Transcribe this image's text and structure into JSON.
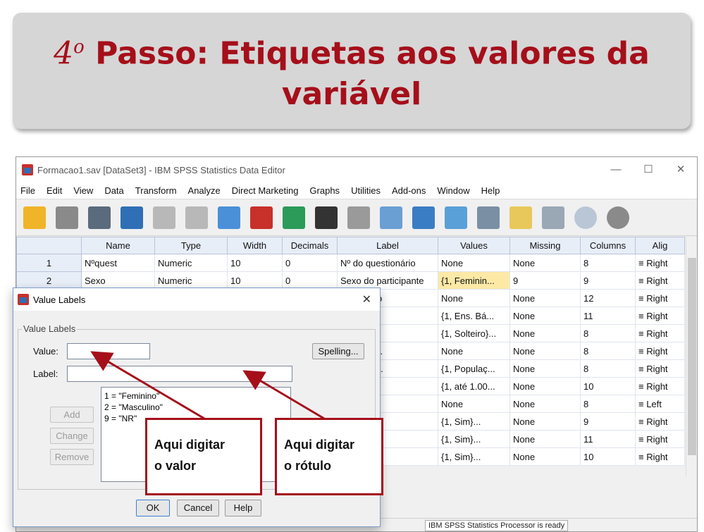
{
  "slide": {
    "title_num": "4",
    "title_sup": "o",
    "title_line1_rest": " Passo: Etiquetas aos valores da",
    "title_line2": "variável"
  },
  "window": {
    "title": "Formacao1.sav [DataSet3] - IBM SPSS Statistics Data Editor",
    "controls": [
      "—",
      "☐",
      "✕"
    ],
    "menu": [
      "File",
      "Edit",
      "View",
      "Data",
      "Transform",
      "Analyze",
      "Direct Marketing",
      "Graphs",
      "Utilities",
      "Add-ons",
      "Window",
      "Help"
    ]
  },
  "grid": {
    "columns": [
      "",
      "Name",
      "Type",
      "Width",
      "Decimals",
      "Label",
      "Values",
      "Missing",
      "Columns",
      "Alig"
    ],
    "rows": [
      {
        "n": "1",
        "name": "Nºquest",
        "type": "Numeric",
        "width": "10",
        "decimals": "0",
        "label": "Nº do questionário",
        "values": "None",
        "missing": "None",
        "columns": "8",
        "align": "≡ Right"
      },
      {
        "n": "2",
        "name": "Sexo",
        "type": "Numeric",
        "width": "10",
        "decimals": "0",
        "label": "Sexo do participante",
        "values": "{1, Feminin...",
        "missing": "9",
        "columns": "9",
        "align": "≡ Right"
      },
      {
        "n": "",
        "name": "",
        "type": "",
        "width": "",
        "decimals": "",
        "label": "ascimento",
        "values": "None",
        "missing": "None",
        "columns": "12",
        "align": "≡ Right"
      },
      {
        "n": "",
        "name": "",
        "type": "",
        "width": "",
        "decimals": "",
        "label": "ies",
        "values": "{1, Ens. Bá...",
        "missing": "None",
        "columns": "11",
        "align": "≡ Right"
      },
      {
        "n": "",
        "name": "",
        "type": "",
        "width": "",
        "decimals": "",
        "label": "vil",
        "values": "{1, Solteiro}...",
        "missing": "None",
        "columns": "8",
        "align": "≡ Right"
      },
      {
        "n": "",
        "name": "",
        "type": "",
        "width": "",
        "decimals": "",
        "label": "le eleme...",
        "values": "None",
        "missing": "None",
        "columns": "8",
        "align": "≡ Right"
      },
      {
        "n": "",
        "name": "",
        "type": "",
        "width": "",
        "decimals": "",
        "label": "face ao t...",
        "values": "{1, Populaç...",
        "missing": "None",
        "columns": "8",
        "align": "≡ Right"
      },
      {
        "n": "",
        "name": "",
        "type": "",
        "width": "",
        "decimals": "",
        "label": "de rendi...",
        "values": "{1, até 1.00...",
        "missing": "None",
        "columns": "10",
        "align": "≡ Right"
      },
      {
        "n": "",
        "name": "",
        "type": "",
        "width": "",
        "decimals": "",
        "label": "",
        "values": "None",
        "missing": "None",
        "columns": "8",
        "align": "≡ Left"
      },
      {
        "n": "",
        "name": "",
        "type": "",
        "width": "",
        "decimals": "",
        "label": "statísti...",
        "values": "{1, Sim}...",
        "missing": "None",
        "columns": "9",
        "align": "≡ Right"
      },
      {
        "n": "",
        "name": "",
        "type": "",
        "width": "",
        "decimals": "",
        "label": "l",
        "values": "{1, Sim}...",
        "missing": "None",
        "columns": "11",
        "align": "≡ Right"
      },
      {
        "n": "",
        "name": "",
        "type": "",
        "width": "",
        "decimals": "",
        "label": "S",
        "values": "{1, Sim}...",
        "missing": "None",
        "columns": "10",
        "align": "≡ Right"
      }
    ]
  },
  "status": "IBM SPSS Statistics Processor is ready",
  "dialog": {
    "title": "Value Labels",
    "group": "Value Labels",
    "value_label": "Value:",
    "label_label": "Label:",
    "value_input": "",
    "label_input": "",
    "spelling": "Spelling...",
    "add": "Add",
    "change": "Change",
    "remove": "Remove",
    "list": [
      "1 = \"Feminino\"",
      "2 = \"Masculino\"",
      "9 = \"NR\""
    ],
    "ok": "OK",
    "cancel": "Cancel",
    "help": "Help"
  },
  "callouts": {
    "left_line1": "Aqui digitar",
    "left_line2": "o valor",
    "right_line1": "Aqui digitar",
    "right_line2": "o rótulo"
  },
  "colors": {
    "title_red": "#a50f1a",
    "highlight": "#fde9a6"
  }
}
